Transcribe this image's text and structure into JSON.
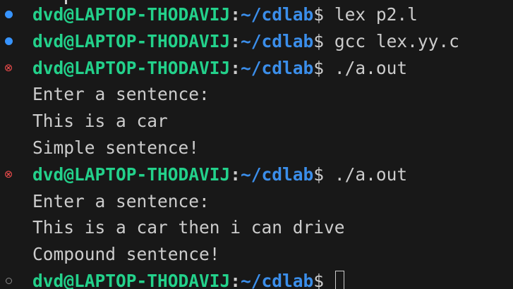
{
  "prompt": {
    "user_host": "dvd@LAPTOP-THODAVIJ",
    "separator": ":",
    "path": "~/cdlab",
    "symbol": "$"
  },
  "lines": [
    {
      "type": "prompt",
      "status": "success",
      "command": "lex p2.l"
    },
    {
      "type": "prompt",
      "status": "success",
      "command": "gcc lex.yy.c"
    },
    {
      "type": "prompt",
      "status": "error",
      "command": "./a.out"
    },
    {
      "type": "output",
      "text": "Enter a sentence:"
    },
    {
      "type": "output",
      "text": "This is a car"
    },
    {
      "type": "output",
      "text": "Simple sentence!"
    },
    {
      "type": "prompt",
      "status": "error",
      "command": "./a.out"
    },
    {
      "type": "output",
      "text": "Enter a sentence:"
    },
    {
      "type": "output",
      "text": "This is a car then i can drive"
    },
    {
      "type": "output",
      "text": "Compound sentence!"
    },
    {
      "type": "prompt",
      "status": "idle",
      "command": ""
    }
  ],
  "status_icons": {
    "success": "filled-dot-icon",
    "error": "error-circle-icon",
    "idle": "empty-circle-icon"
  },
  "colors": {
    "background": "#181818",
    "user_host": "#23d18b",
    "path": "#3b8eea",
    "text": "#cccccc",
    "success_dot": "#3794ff",
    "error_icon": "#f14c4c",
    "idle_dot": "#8b8b8b"
  },
  "error_glyph": "⊗"
}
